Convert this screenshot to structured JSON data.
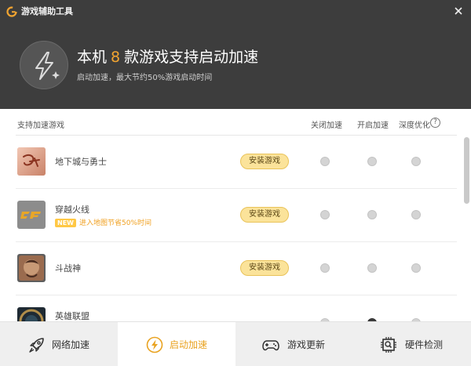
{
  "window": {
    "title": "游戏辅助工具",
    "logo_icon": "g-logo-icon",
    "close_icon": "close-icon"
  },
  "hero": {
    "icon": "lightning-sparkle-icon",
    "title_prefix": "本机",
    "game_count": "8",
    "title_suffix": "款游戏支持启动加速",
    "subtitle": "启动加速，最大节约50%游戏启动时间",
    "accent_color": "#f3a531"
  },
  "list_header": {
    "title": "支持加速游戏",
    "col_off": "关闭加速",
    "col_on": "开启加速",
    "col_deep": "深度优化",
    "help": "?"
  },
  "games": [
    {
      "name": "地下城与勇士",
      "promo_badge": "",
      "promo_text": "",
      "button": "安装游戏",
      "selected": "none",
      "icon": "dnf-logo-icon"
    },
    {
      "name": "穿越火线",
      "promo_badge": "NEW",
      "promo_text": "进入地图节省50%时间",
      "button": "安装游戏",
      "selected": "none",
      "icon": "cf-logo-icon"
    },
    {
      "name": "斗战神",
      "promo_badge": "",
      "promo_text": "",
      "button": "安装游戏",
      "selected": "none",
      "icon": "dzs-logo-icon"
    },
    {
      "name": "英雄联盟",
      "promo_badge": "",
      "promo_text": "",
      "button": "",
      "selected": "on",
      "icon": "lol-logo-icon"
    }
  ],
  "nav": [
    {
      "label": "网络加速",
      "icon": "rocket-icon",
      "active": false
    },
    {
      "label": "启动加速",
      "icon": "lightning-icon",
      "active": true
    },
    {
      "label": "游戏更新",
      "icon": "gamepad-icon",
      "active": false
    },
    {
      "label": "硬件检测",
      "icon": "chip-icon",
      "active": false
    }
  ],
  "colors": {
    "header_bg": "#3d3d3d",
    "active_nav_label": "#e9a321",
    "install_button": "#fbe39a"
  }
}
